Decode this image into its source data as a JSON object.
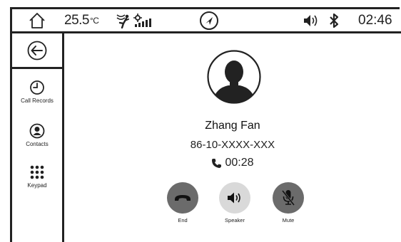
{
  "status_bar": {
    "temperature": "25.5",
    "temperature_unit": "°C",
    "time": "02:46",
    "icons": [
      "home-icon",
      "fan-direction-icon",
      "fan-speed-icon",
      "navigation-icon",
      "volume-icon",
      "bluetooth-icon"
    ]
  },
  "sidebar": {
    "back_icon": "back-arrow-icon",
    "items": [
      {
        "label": "Call Records",
        "icon": "clock-icon"
      },
      {
        "label": "Contacts",
        "icon": "contact-icon"
      },
      {
        "label": "Keypad",
        "icon": "keypad-icon"
      }
    ]
  },
  "call": {
    "name": "Zhang Fan",
    "number": "86-10-XXXX-XXX",
    "duration": "00:28",
    "avatar_icon": "person-avatar-icon",
    "duration_icon": "phone-icon"
  },
  "controls": [
    {
      "label": "End",
      "icon": "hangup-icon",
      "color": "#6b6b6b"
    },
    {
      "label": "Speaker",
      "icon": "speaker-icon",
      "color": "#d9d9d9"
    },
    {
      "label": "Mute",
      "icon": "mic-off-icon",
      "color": "#6b6b6b"
    }
  ]
}
